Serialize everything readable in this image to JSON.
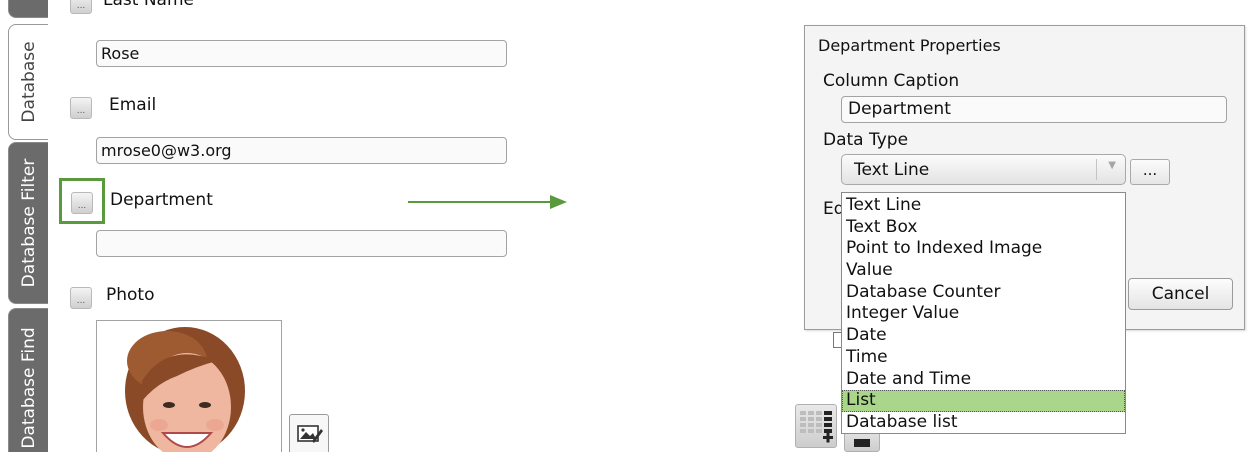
{
  "sidebar": {
    "tabs": [
      {
        "label": "Database"
      },
      {
        "label": "Database Filter"
      },
      {
        "label": "Database Find"
      }
    ]
  },
  "form": {
    "option_button_label": "...",
    "fields": [
      {
        "label": "Last Name",
        "value": "Rose"
      },
      {
        "label": "Email",
        "value": "mrose0@w3.org"
      },
      {
        "label": "Department",
        "value": ""
      },
      {
        "label": "Photo"
      }
    ]
  },
  "dialog": {
    "title": "Department Properties",
    "column_caption_label": "Column Caption",
    "column_caption_value": "Department",
    "data_type_label": "Data Type",
    "data_type_value": "Text Line",
    "dots_button": "...",
    "partial_label": "Ed",
    "cancel_button": "Cancel"
  },
  "dropdown": {
    "options": [
      "Text Line",
      "Text Box",
      "Point to Indexed Image",
      "Value",
      "Database Counter",
      "Integer Value",
      "Date",
      "Time",
      "Date and Time",
      "List",
      "Database list"
    ],
    "selected": "List"
  },
  "colors": {
    "highlight": "#5a9a3c",
    "selected_option": "#a9d68a",
    "tab_inactive": "#6b6b6b"
  }
}
